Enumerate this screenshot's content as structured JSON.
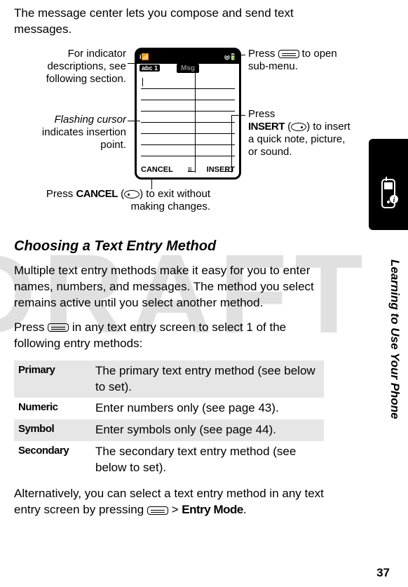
{
  "intro": "The message center lets you compose and send text messages.",
  "draft_watermark": "DRAFT",
  "callouts": {
    "indicators": "For indicator descriptions, see following section.",
    "cursor_line1_italic": "Flashing cursor",
    "cursor_line2": "indicates insertion point.",
    "cancel_pre": "Press ",
    "cancel_bold": "CANCEL",
    "cancel_post": ") to exit without making changes.",
    "menu_pre": "Press ",
    "menu_post": " to open sub-menu.",
    "insert_pre": "Press",
    "insert_bold": "INSERT",
    "insert_post": ") to insert a quick note, picture, or sound."
  },
  "phone": {
    "signal_label": "i",
    "mode_chip": "abc 1",
    "screen_title": "Msg",
    "softkey_left": "CANCEL",
    "softkey_right": "INSERT"
  },
  "section_heading": "Choosing a Text Entry Method",
  "section_para1": "Multiple text entry methods make it easy for you to enter names, numbers, and messages. The method you select remains active until you select another method.",
  "section_para2_pre": "Press ",
  "section_para2_post": " in any text entry screen to select 1 of the following entry methods:",
  "methods": [
    {
      "name": "Primary",
      "desc": "The primary text entry method (see below to set)."
    },
    {
      "name": "Numeric",
      "desc": "Enter numbers only (see page 43)."
    },
    {
      "name": "Symbol",
      "desc": "Enter symbols only (see page 44)."
    },
    {
      "name": "Secondary",
      "desc": "The secondary text entry method (see below to set)."
    }
  ],
  "closing_pre": "Alternatively, you can select a text entry method in any text entry screen by pressing ",
  "closing_gt": " > ",
  "closing_bold": "Entry Mode",
  "closing_period": ".",
  "side_label": "Learning to Use Your Phone",
  "page_number": "37"
}
